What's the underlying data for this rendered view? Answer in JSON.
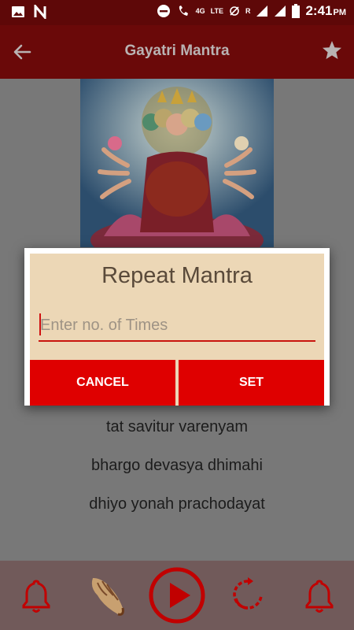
{
  "status_bar": {
    "time": "2:41",
    "ampm": "PM",
    "network": "4G",
    "lte": "LTE",
    "roaming": "R"
  },
  "app_bar": {
    "title": "Gayatri Mantra"
  },
  "lyrics": [
    "tat savitur varenyam",
    "bhargo devasya dhimahi",
    "dhiyo yonah prachodayat"
  ],
  "dialog": {
    "title": "Repeat Mantra",
    "input_placeholder": "Enter no. of Times",
    "input_value": "",
    "cancel_label": "CANCEL",
    "set_label": "SET"
  },
  "bottom_bar": {
    "icons": [
      "bell-icon",
      "conch-shell-icon",
      "play-icon",
      "repeat-icon",
      "bell-icon"
    ]
  },
  "colors": {
    "status_bar": "#5e0808",
    "app_bar": "#6a0909",
    "accent_red": "#df0000",
    "dialog_bg": "#ecd7b6",
    "icon_red": "#c10000"
  }
}
